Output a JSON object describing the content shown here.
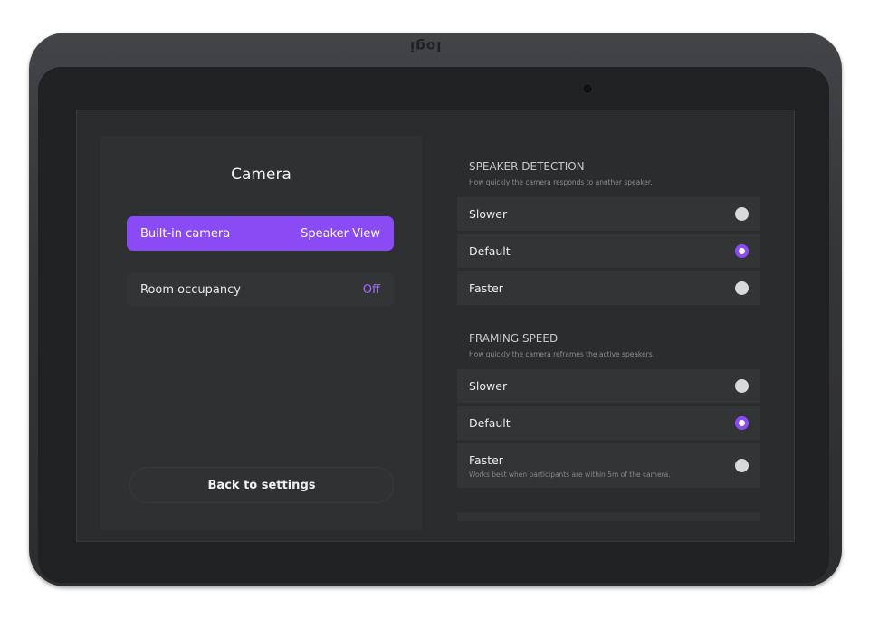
{
  "device": {
    "brand_logo": "logi"
  },
  "left": {
    "title": "Camera",
    "items": [
      {
        "label": "Built-in camera",
        "value": "Speaker View",
        "selected": true
      },
      {
        "label": "Room occupancy",
        "value": "Off",
        "selected": false
      }
    ],
    "back_label": "Back to settings"
  },
  "speaker_detection": {
    "heading": "SPEAKER DETECTION",
    "description": "How quickly the camera responds to another speaker.",
    "options": [
      {
        "label": "Slower",
        "selected": false
      },
      {
        "label": "Default",
        "selected": true
      },
      {
        "label": "Faster",
        "selected": false
      }
    ]
  },
  "framing_speed": {
    "heading": "FRAMING SPEED",
    "description": "How quickly the camera reframes the active speakers.",
    "options": [
      {
        "label": "Slower",
        "selected": false
      },
      {
        "label": "Default",
        "selected": true
      },
      {
        "label": "Faster",
        "note": "Works best when participants are within 5m of the camera.",
        "selected": false
      }
    ]
  },
  "colors": {
    "accent": "#8a4bf5",
    "panel": "#333436",
    "background": "#2b2c2e"
  }
}
